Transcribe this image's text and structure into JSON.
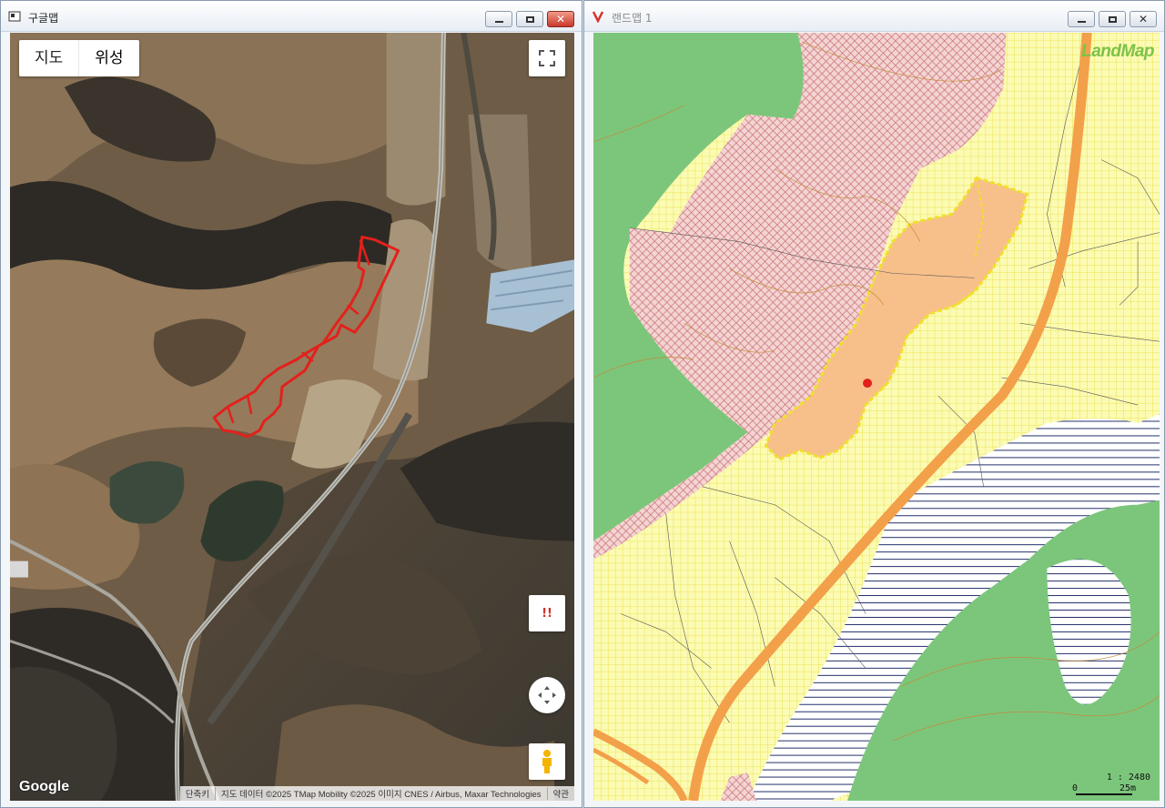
{
  "left_window": {
    "title": "구글맵",
    "map_types": [
      "지도",
      "위성"
    ],
    "active_map_type": "위성",
    "warn_label": "!!",
    "logo": "Google",
    "attribution": [
      "단축키",
      "지도 데이터 ©2025 TMap Mobility ©2025 이미지 CNES / Airbus, Maxar Technologies",
      "약관"
    ]
  },
  "right_window": {
    "title": "랜드맵 1",
    "logo": "LandMap",
    "scale_ratio": "1 : 2480",
    "scale_start": "0",
    "scale_end": "25m"
  },
  "colors": {
    "parcel_outline": "#e2211c",
    "forest_green": "#7cc67c",
    "yellow_grid": "#f7f79a",
    "pink_hatch": "#f2c4c4",
    "orange_target": "#f7c08a",
    "road_orange": "#f3a04a"
  }
}
